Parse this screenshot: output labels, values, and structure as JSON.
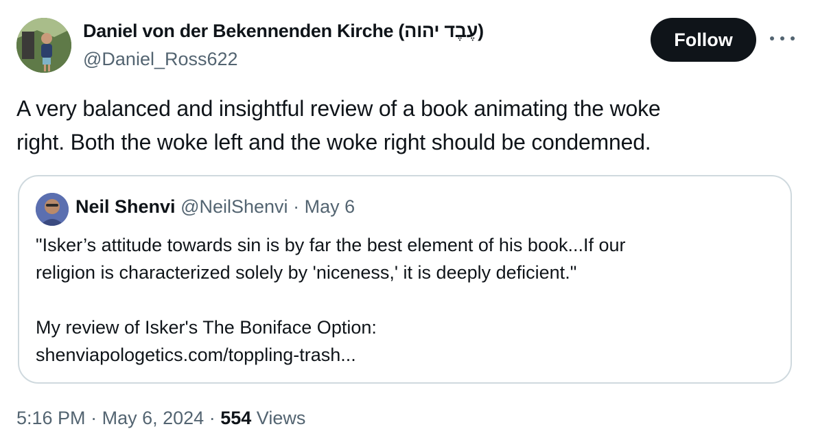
{
  "author": {
    "display_name": "Daniel von der Bekennenden Kirche (עֶבֶד יהוה)",
    "handle": "@Daniel_Ross622",
    "avatar_icon": "user-avatar-photo"
  },
  "actions": {
    "follow_label": "Follow",
    "more_icon": "more-horizontal-icon"
  },
  "tweet": {
    "text_line1": "A very balanced and insightful review of a book animating the woke",
    "text_line2": "right. Both the woke left and the woke right should be condemned."
  },
  "quote": {
    "name": "Neil Shenvi",
    "handle": "@NeilShenvi",
    "separator": "·",
    "date": "May 6",
    "line1": "\"Isker’s attitude towards sin is by far the best element of his book...If our",
    "line2": "religion is characterized solely by 'niceness,' it is deeply deficient.\"",
    "line3": "My review of Isker's The Boniface Option:",
    "link": "shenviapologetics.com/toppling-trash..."
  },
  "footer": {
    "time": "5:16 PM",
    "sep1": "·",
    "date": "May 6, 2024",
    "sep2": "·",
    "views_count": "554",
    "views_label": "Views"
  },
  "colors": {
    "text_primary": "#0f1419",
    "text_secondary": "#536471",
    "border": "#cfd9de",
    "button_bg": "#0f1419"
  }
}
